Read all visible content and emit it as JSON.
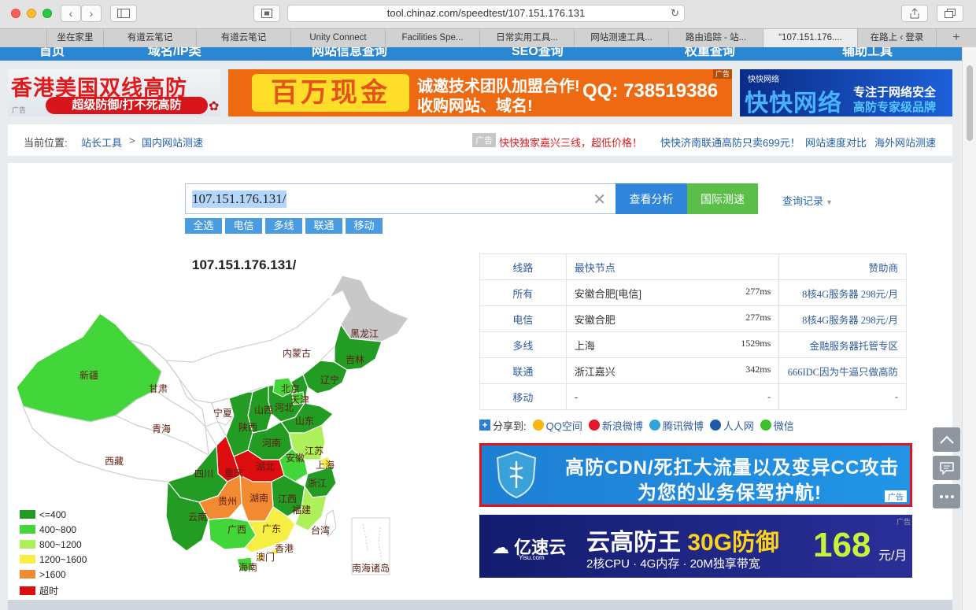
{
  "browser": {
    "url": "tool.chinaz.com/speedtest/107.151.176.131",
    "tabs": [
      "坐在家里",
      "有道云笔记",
      "有道云笔记",
      "Unity Connect",
      "Facilities Spe...",
      "日常实用工具...",
      "网站测速工具...",
      "路由追踪 - 站...",
      "“107.151.176....",
      "在路上 ‹ 登录"
    ]
  },
  "nav": {
    "items": [
      "首页",
      "域名/IP类",
      "网站信息查询",
      "SEO查询",
      "权重查询",
      "辅助工具"
    ]
  },
  "ads": {
    "ad1_title": "香港美国双线高防",
    "ad1_sub": "超级防御/打不死高防",
    "ad_label": "广告",
    "ad2_box": "百万现金",
    "ad2_line1": "诚邀技术团队加盟合作!",
    "ad2_line2": "收购网站、域名!",
    "ad2_qq": "QQ: 738519386",
    "ad3_small": "快快网络",
    "ad3_brand": "快快网络",
    "ad3_s1": "专注于网络安全",
    "ad3_s2": "高防专家级品牌",
    "ad4_line1": "高防CDN/死扛大流量以及变异CC攻击",
    "ad4_line2": "为您的业务保驾护航!",
    "ad5_logo": "亿速云",
    "ad5_logo_sub": "Yisu.com",
    "ad5_title_a": "云高防王 ",
    "ad5_title_b": "30G防御",
    "ad5_sub": "2核CPU · 4G内存 · 20M独享带宽",
    "ad5_price": "168",
    "ad5_unit": "元/月"
  },
  "breadcrumb": {
    "label": "当前位置:",
    "item1": "站长工具",
    "sep": ">",
    "item2": "国内网站测速",
    "badge": "广告",
    "hot_link": "快快独家嘉兴三线，超低价格！",
    "link3": "快快济南联通高防只卖699元！",
    "link4": "网站速度对比",
    "link5": "海外网站测速"
  },
  "search": {
    "value": "107.151.176.131/",
    "analyze_label": "查看分析",
    "intl_label": "国际测速",
    "history_label": "查询记录"
  },
  "filters": [
    "全选",
    "电信",
    "多线",
    "联通",
    "移动"
  ],
  "map": {
    "title": "107.151.176.131/",
    "provinces": {
      "heilongjiang": "黑龙江",
      "jilin": "吉林",
      "liaoning": "辽宁",
      "neimenggu": "内蒙古",
      "beijing": "北京",
      "tianjin": "天津",
      "hebei": "河北",
      "shanxi": "山西",
      "shandong": "山东",
      "ningxia": "宁夏",
      "gansu": "甘肃",
      "xinjiang": "新疆",
      "qinghai": "青海",
      "xizang": "西藏",
      "shaanxi": "陕西",
      "henan": "河南",
      "jiangsu": "江苏",
      "anhui": "安徽",
      "shanghai": "上海",
      "hubei": "湖北",
      "sichuan": "四川",
      "chongqing": "重庆",
      "zhejiang": "浙江",
      "guizhou": "贵州",
      "hunan": "湖南",
      "jiangxi": "江西",
      "fujian": "福建",
      "yunnan": "云南",
      "guangxi": "广西",
      "guangdong": "广东",
      "taiwan": "台湾",
      "hongkong": "香港",
      "macao": "澳门",
      "hainan": "海南",
      "nanhai": "南海诸岛"
    },
    "legend": [
      {
        "label": "<=400",
        "color": "#239c23"
      },
      {
        "label": "400~800",
        "color": "#43d63a"
      },
      {
        "label": "800~1200",
        "color": "#aef05a"
      },
      {
        "label": "1200~1600",
        "color": "#f7ef44"
      },
      {
        "label": ">1600",
        "color": "#f28a32"
      },
      {
        "label": "超时",
        "color": "#dd0d0f"
      }
    ]
  },
  "table": {
    "headers": {
      "line": "线路",
      "node": "最快节点",
      "sponsor": "赞助商"
    },
    "rows": [
      {
        "line": "所有",
        "node": "安徽合肥[电信]",
        "ms": "277ms",
        "sponsor": "8核4G服务器 298元/月"
      },
      {
        "line": "电信",
        "node": "安徽合肥",
        "ms": "277ms",
        "sponsor": "8核4G服务器 298元/月"
      },
      {
        "line": "多线",
        "node": "上海",
        "ms": "1529ms",
        "sponsor": "金融服务器托管专区"
      },
      {
        "line": "联通",
        "node": "浙江嘉兴",
        "ms": "342ms",
        "sponsor": "666IDC因为牛逼只做高防"
      },
      {
        "line": "移动",
        "node": "-",
        "ms": "-",
        "sponsor": "-"
      }
    ]
  },
  "share": {
    "label": "分享到:",
    "items": [
      "QQ空间",
      "新浪微博",
      "腾讯微博",
      "人人网",
      "微信"
    ]
  },
  "colors": {
    "nav_blue": "#2c87d2",
    "link_blue": "#2f5c9c",
    "analyze_btn": "#2e85d9",
    "intl_btn": "#5bbe49",
    "map_gray": "#c8c8c8"
  }
}
